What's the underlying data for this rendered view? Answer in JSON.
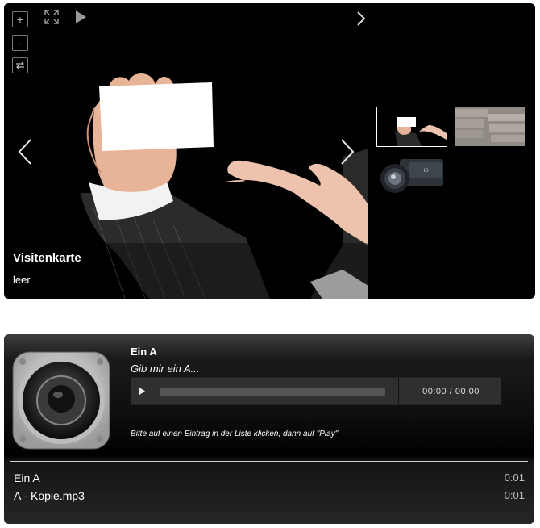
{
  "gallery": {
    "controls": {
      "zoom_in_label": "+",
      "zoom_out_label": "-",
      "rotate_icon": "rotate-icon",
      "fullscreen_icon": "fullscreen-icon",
      "slideshow_icon": "play-icon"
    },
    "caption": {
      "title": "Visitenkarte",
      "description": "leer"
    },
    "thumbnails": [
      {
        "name": "business-card-thumbnail",
        "active": true
      },
      {
        "name": "folder-tabs-thumbnail",
        "active": false
      },
      {
        "name": "camcorder-thumbnail",
        "active": false
      }
    ]
  },
  "player": {
    "title": "Ein A",
    "subtitle": "Gib mir ein A...",
    "time": "00:00 / 00:00",
    "progress": 0,
    "hint": "Bitte auf einen Eintrag in der Liste klicken, dann auf \"Play\"",
    "playlist": [
      {
        "name": "Ein A",
        "duration": "0:01"
      },
      {
        "name": "A - Kopie.mp3",
        "duration": "0:01"
      }
    ]
  }
}
